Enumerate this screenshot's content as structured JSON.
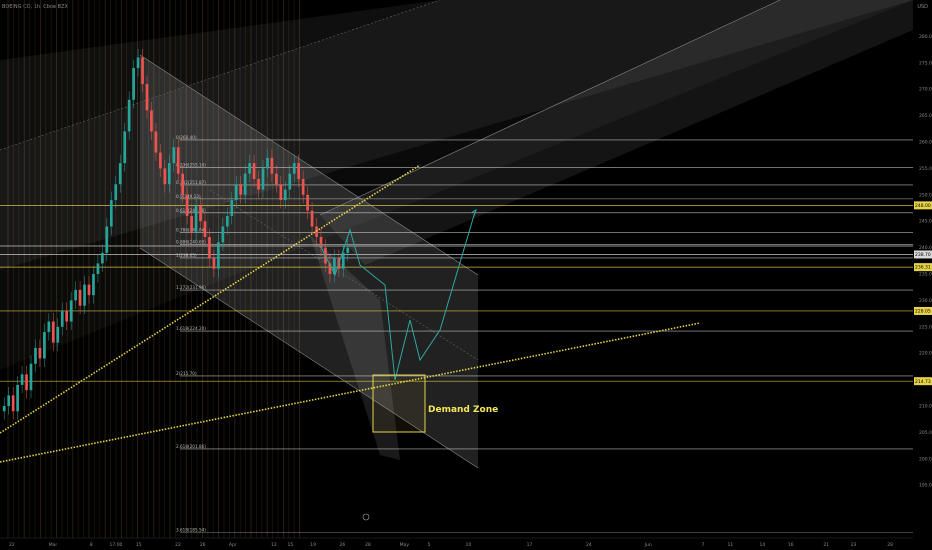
{
  "header": {
    "symbol_label": "BOEING CO, 1h, Cboe BZX",
    "scale_label": "USD"
  },
  "colors": {
    "background": "#000000",
    "up": "#26a69a",
    "down": "#ef5350",
    "grid_vertical": "#3a2a12",
    "fib_line": "#d9d9d9",
    "yellow_line": "#e6d34a",
    "dotted_yellow": "#e6d34a",
    "channel_fill": "#ffffff",
    "projection": "#2ea8a0",
    "demand_box": "#e6d34a"
  },
  "chart_data": {
    "type": "candlestick",
    "title": "",
    "xlabel": "",
    "ylabel": "",
    "ylim": [
      185,
      285
    ],
    "y_ticks": [
      195,
      200,
      205,
      210,
      215,
      220,
      225,
      230,
      235,
      240,
      245,
      250,
      255,
      260,
      265,
      270,
      275,
      280
    ],
    "y_tick_labels": [
      "195.00",
      "200.00",
      "205.00",
      "210.00",
      "215.00",
      "220.00",
      "225.00",
      "230.00",
      "235.00",
      "240.00",
      "245.00",
      "250.00",
      "255.00",
      "260.00",
      "265.00",
      "270.00",
      "275.00",
      "280.00"
    ],
    "x_ticks": [
      {
        "label": "22",
        "pos": 0.013
      },
      {
        "label": "Mar",
        "pos": 0.058
      },
      {
        "label": "8",
        "pos": 0.1
      },
      {
        "label": "17:00",
        "pos": 0.127
      },
      {
        "label": "15",
        "pos": 0.152
      },
      {
        "label": "22",
        "pos": 0.195
      },
      {
        "label": "26",
        "pos": 0.222
      },
      {
        "label": "Apr",
        "pos": 0.255
      },
      {
        "label": "12",
        "pos": 0.3
      },
      {
        "label": "15",
        "pos": 0.318
      },
      {
        "label": "19",
        "pos": 0.343
      },
      {
        "label": "26",
        "pos": 0.375
      },
      {
        "label": "28",
        "pos": 0.403
      },
      {
        "label": "May",
        "pos": 0.443
      },
      {
        "label": "5",
        "pos": 0.47
      },
      {
        "label": "10",
        "pos": 0.513
      },
      {
        "label": "17",
        "pos": 0.58
      },
      {
        "label": "24",
        "pos": 0.645
      },
      {
        "label": "Jun",
        "pos": 0.71
      },
      {
        "label": "7",
        "pos": 0.77
      },
      {
        "label": "11",
        "pos": 0.8
      },
      {
        "label": "14",
        "pos": 0.835
      },
      {
        "label": "16",
        "pos": 0.866
      },
      {
        "label": "21",
        "pos": 0.905
      },
      {
        "label": "23",
        "pos": 0.935
      },
      {
        "label": "28",
        "pos": 0.975
      }
    ],
    "candles_close": [
      210,
      212,
      209,
      214,
      216,
      213,
      218,
      221,
      219,
      224,
      226,
      222,
      225,
      228,
      226,
      230,
      232,
      229,
      233,
      231,
      235,
      237,
      239,
      244,
      249,
      252,
      256,
      262,
      268,
      274,
      276,
      271,
      266,
      262,
      258,
      255,
      252,
      256,
      259,
      254,
      250,
      246,
      243,
      248,
      245,
      242,
      238,
      236,
      241,
      244,
      246,
      249,
      252,
      250,
      254,
      256,
      253,
      251,
      255,
      257,
      254,
      252,
      249,
      251,
      254,
      256,
      253,
      250,
      247,
      244,
      242,
      240,
      237,
      235,
      238,
      236,
      239,
      240
    ],
    "fib_levels": [
      {
        "label": "0(260.40)",
        "price": 260.4
      },
      {
        "label": "0.236(255.14)",
        "price": 255.14
      },
      {
        "label": "0.382(251.87)",
        "price": 251.87
      },
      {
        "label": "0.5(249.23)",
        "price": 249.23
      },
      {
        "label": "0.618(246.58)",
        "price": 246.58
      },
      {
        "label": "0.786(242.84)",
        "price": 242.84
      },
      {
        "label": "0.886(240.60)",
        "price": 240.6
      },
      {
        "label": "1(238.05)",
        "price": 238.05
      },
      {
        "label": "1.272(231.96)",
        "price": 231.96
      },
      {
        "label": "1.618(224.20)",
        "price": 224.2
      },
      {
        "label": "2(215.70)",
        "price": 215.7
      },
      {
        "label": "2.618(201.86)",
        "price": 201.86
      }
    ],
    "horizontal_levels": [
      {
        "price": 248.0,
        "label": "248.00",
        "color": "#e6d34a"
      },
      {
        "price": 240.3,
        "label": "240.30",
        "color": "#d9d9d9"
      },
      {
        "price": 238.7,
        "label": "238.70",
        "color": "#d9d9d9"
      },
      {
        "price": 236.3,
        "label": "236.31",
        "color": "#e6d34a"
      },
      {
        "price": 228.0,
        "label": "228.05",
        "color": "#e6d34a"
      },
      {
        "price": 214.7,
        "label": "214.73",
        "color": "#e6d34a"
      }
    ],
    "price_tags": [
      {
        "price": 248.0,
        "label": "248.00",
        "bg": "#e6d34a",
        "fg": "#000"
      },
      {
        "price": 238.7,
        "label": "238.70",
        "bg": "#d9d9d9",
        "fg": "#000"
      },
      {
        "price": 236.3,
        "label": "236.31",
        "bg": "#e6d34a",
        "fg": "#000"
      },
      {
        "price": 228.0,
        "label": "228.05",
        "bg": "#e6d34a",
        "fg": "#000"
      },
      {
        "price": 214.7,
        "label": "214.73",
        "bg": "#e6d34a",
        "fg": "#000"
      }
    ],
    "annotations": [
      {
        "text": "Demand Zone"
      }
    ],
    "bottom_fib_label": "3.618(185.54)"
  }
}
